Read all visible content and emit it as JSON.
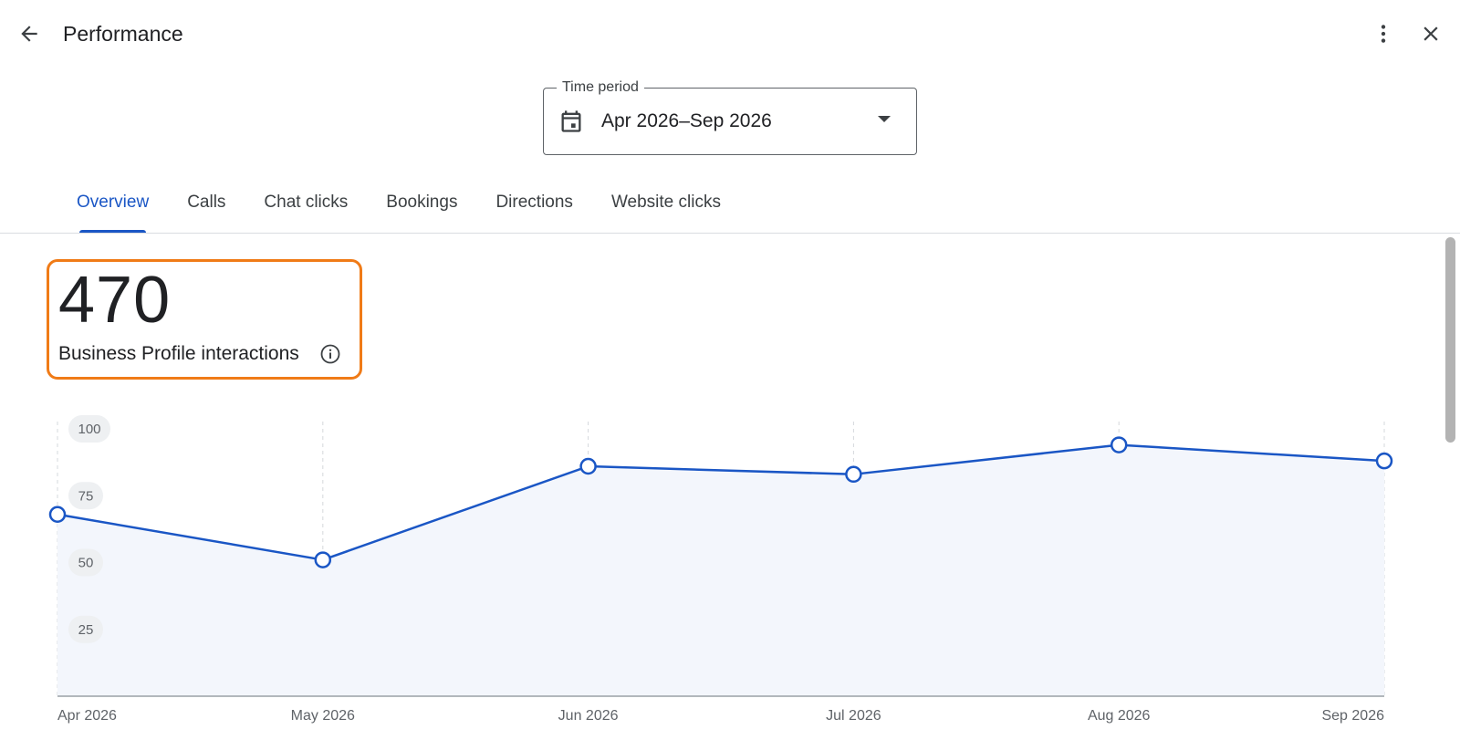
{
  "header": {
    "title": "Performance",
    "back_icon": "arrow-left-icon",
    "more_icon": "more-vert-icon",
    "close_icon": "close-icon"
  },
  "time_period": {
    "label": "Time period",
    "value": "Apr 2026–Sep 2026",
    "icon": "calendar-icon"
  },
  "tabs": [
    {
      "label": "Overview",
      "active": true
    },
    {
      "label": "Calls"
    },
    {
      "label": "Chat clicks"
    },
    {
      "label": "Bookings"
    },
    {
      "label": "Directions"
    },
    {
      "label": "Website clicks"
    }
  ],
  "summary": {
    "value": "470",
    "label": "Business Profile interactions",
    "info_icon": "info-icon"
  },
  "colors": {
    "accent": "#1a56c5",
    "highlight": "#f07b17",
    "area_fill": "#f3f6fc"
  },
  "chart_data": {
    "type": "area",
    "categories": [
      "Apr 2026",
      "May 2026",
      "Jun 2026",
      "Jul 2026",
      "Aug 2026",
      "Sep 2026"
    ],
    "values": [
      68,
      51,
      86,
      83,
      94,
      88
    ],
    "yticks": [
      "100",
      "75",
      "50",
      "25"
    ],
    "ylim": [
      0,
      100
    ],
    "title": "",
    "xlabel": "",
    "ylabel": "",
    "grid": "vertical-dashed"
  }
}
